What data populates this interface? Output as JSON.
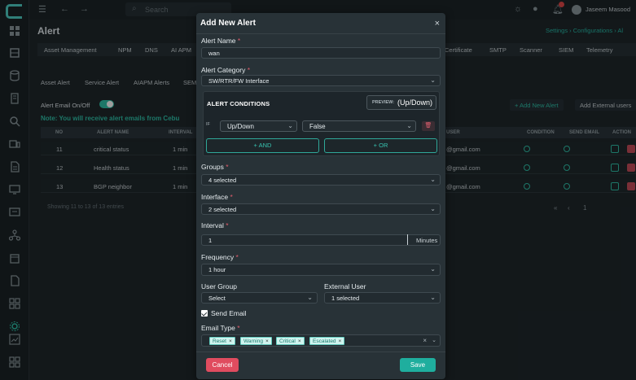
{
  "topbar": {
    "search_placeholder": "Search",
    "user_name": "Jaseem Masood",
    "notification_count": "1"
  },
  "page": {
    "title": "Alert",
    "breadcrumb": "Settings › Configurations › Al"
  },
  "tabs": [
    "Asset Management",
    "NPM",
    "DNS",
    "AI APM",
    "Certificate",
    "SMTP",
    "Scanner",
    "SIEM",
    "Telemetry"
  ],
  "subtabs": [
    "Asset Alert",
    "Service Alert",
    "AIAPM Alerts",
    "SEM"
  ],
  "alert_email_toggle_label": "Alert Email On/Off",
  "note": "Note: You will receive alert emails from Cebu",
  "actions": {
    "add_new_alert": "+ Add New Alert",
    "add_external_users": "Add External users"
  },
  "table": {
    "columns": [
      "NO",
      "ALERT NAME",
      "INTERVAL",
      "USER",
      "CONDITION",
      "SEND EMAIL",
      "ACTION"
    ],
    "rows": [
      {
        "no": "11",
        "name": "critical status",
        "interval": "1 min",
        "user": "@gmail.com"
      },
      {
        "no": "12",
        "name": "Health status",
        "interval": "1 min",
        "user": "@gmail.com"
      },
      {
        "no": "13",
        "name": "BGP neighbor",
        "interval": "1 min",
        "user": "@gmail.com"
      }
    ],
    "showing": "Showing 11 to 13 of 13 entries",
    "pager": {
      "first": "«",
      "prev": "‹",
      "page": "1"
    }
  },
  "modal": {
    "title": "Add New Alert",
    "close": "×",
    "alert_name": {
      "label": "Alert Name",
      "value": "wan"
    },
    "alert_category": {
      "label": "Alert Category",
      "value": "SW/RTR/FW Interface"
    },
    "conditions": {
      "title": "ALERT CONDITIONS",
      "preview_label": "PREVIEW:",
      "preview_value": "(Up/Down)",
      "if_label": "IF",
      "field_value": "Up/Down",
      "operator_value": "False",
      "and_label": "+ AND",
      "or_label": "+ OR"
    },
    "groups": {
      "label": "Groups",
      "value": "4 selected"
    },
    "interface": {
      "label": "Interface",
      "value": "2 selected"
    },
    "interval": {
      "label": "Interval",
      "value": "1",
      "unit": "Minutes"
    },
    "frequency": {
      "label": "Frequency",
      "value": "1 hour"
    },
    "user_group": {
      "label": "User Group",
      "value": "Select"
    },
    "external_user": {
      "label": "External User",
      "value": "1 selected"
    },
    "send_email": {
      "label": "Send Email",
      "checked": true
    },
    "email_type": {
      "label": "Email Type",
      "tags": [
        "Reset",
        "Warning",
        "Critical",
        "Escalated"
      ]
    },
    "cancel_label": "Cancel",
    "save_label": "Save"
  },
  "colors": {
    "accent": "#1fae9e",
    "danger": "#e04c5f",
    "modal_bg": "#283237",
    "page_bg": "#1f272b"
  }
}
